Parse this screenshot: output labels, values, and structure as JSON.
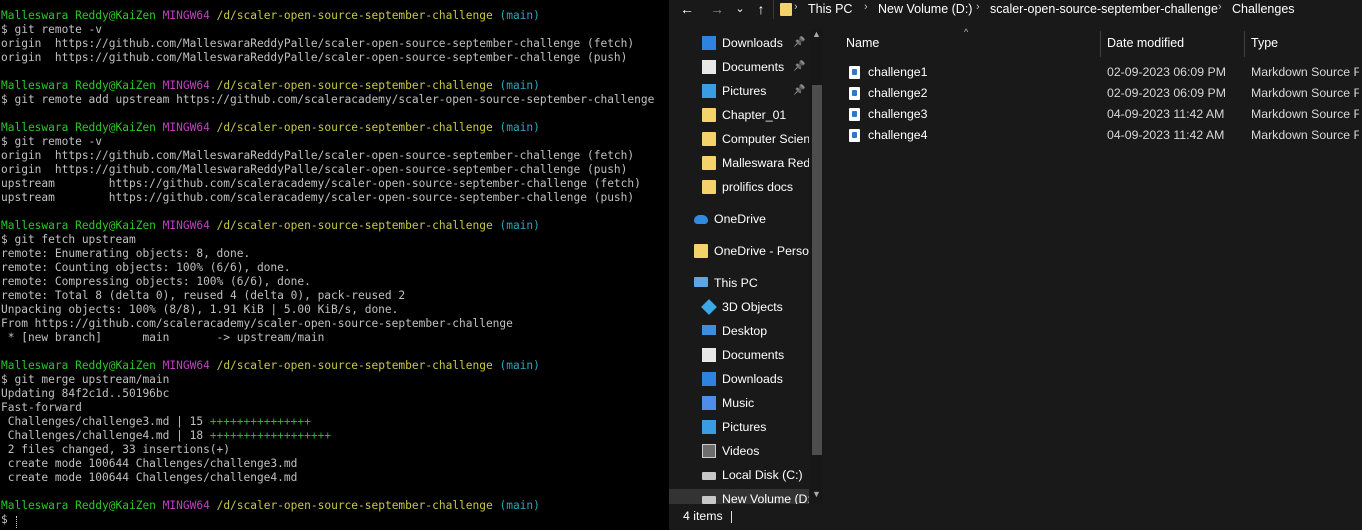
{
  "terminal": {
    "blocks": [
      {
        "prompt": {
          "user": "Malleswara Reddy@KaiZen",
          "sys": "MINGW64",
          "path": "/d/scaler-open-source-september-challenge",
          "branch": "(main)"
        },
        "command": "$ git remote -v",
        "output": [
          "origin  https://github.com/MalleswaraReddyPalle/scaler-open-source-september-challenge (fetch)",
          "origin  https://github.com/MalleswaraReddyPalle/scaler-open-source-september-challenge (push)"
        ]
      },
      {
        "prompt": {
          "user": "Malleswara Reddy@KaiZen",
          "sys": "MINGW64",
          "path": "/d/scaler-open-source-september-challenge",
          "branch": "(main)"
        },
        "command": "$ git remote add upstream https://github.com/scaleracademy/scaler-open-source-september-challenge",
        "output": []
      },
      {
        "prompt": {
          "user": "Malleswara Reddy@KaiZen",
          "sys": "MINGW64",
          "path": "/d/scaler-open-source-september-challenge",
          "branch": "(main)"
        },
        "command": "$ git remote -v",
        "output": [
          "origin  https://github.com/MalleswaraReddyPalle/scaler-open-source-september-challenge (fetch)",
          "origin  https://github.com/MalleswaraReddyPalle/scaler-open-source-september-challenge (push)",
          "upstream        https://github.com/scaleracademy/scaler-open-source-september-challenge (fetch)",
          "upstream        https://github.com/scaleracademy/scaler-open-source-september-challenge (push)"
        ]
      },
      {
        "prompt": {
          "user": "Malleswara Reddy@KaiZen",
          "sys": "MINGW64",
          "path": "/d/scaler-open-source-september-challenge",
          "branch": "(main)"
        },
        "command": "$ git fetch upstream",
        "output": [
          "remote: Enumerating objects: 8, done.",
          "remote: Counting objects: 100% (6/6), done.",
          "remote: Compressing objects: 100% (6/6), done.",
          "remote: Total 8 (delta 0), reused 4 (delta 0), pack-reused 2",
          "Unpacking objects: 100% (8/8), 1.91 KiB | 5.00 KiB/s, done.",
          "From https://github.com/scaleracademy/scaler-open-source-september-challenge",
          " * [new branch]      main       -> upstream/main"
        ]
      },
      {
        "prompt": {
          "user": "Malleswara Reddy@KaiZen",
          "sys": "MINGW64",
          "path": "/d/scaler-open-source-september-challenge",
          "branch": "(main)"
        },
        "command": "$ git merge upstream/main",
        "output": [
          "Updating 84f2c1d..50196bc",
          "Fast-forward"
        ],
        "diffstat": [
          {
            "text": " Challenges/challenge3.md | 15 ",
            "plus": "+++++++++++++++"
          },
          {
            "text": " Challenges/challenge4.md | 18 ",
            "plus": "++++++++++++++++++"
          }
        ],
        "output2": [
          " 2 files changed, 33 insertions(+)",
          " create mode 100644 Challenges/challenge3.md",
          " create mode 100644 Challenges/challenge4.md"
        ]
      },
      {
        "prompt": {
          "user": "Malleswara Reddy@KaiZen",
          "sys": "MINGW64",
          "path": "/d/scaler-open-source-september-challenge",
          "branch": "(main)"
        },
        "command": "$ ",
        "output": []
      }
    ]
  },
  "explorer": {
    "nav_buttons": {
      "back": "←",
      "forward": "→",
      "recent": "⌄",
      "up": "↑"
    },
    "breadcrumbs": [
      "This PC",
      "New Volume (D:)",
      "scaler-open-source-september-challenge",
      "Challenges"
    ],
    "breadcrumb_sep": "›",
    "nav_items": [
      {
        "label": "Downloads",
        "icon": "download-icon",
        "pinned": true
      },
      {
        "label": "Documents",
        "icon": "documents-icon",
        "pinned": true
      },
      {
        "label": "Pictures",
        "icon": "pictures-icon",
        "pinned": true
      },
      {
        "label": "Chapter_01",
        "icon": "folder-icon",
        "pinned": false
      },
      {
        "label": "Computer Scien",
        "icon": "folder-icon",
        "pinned": false
      },
      {
        "label": "Malleswara Redd",
        "icon": "folder-icon",
        "pinned": false
      },
      {
        "label": "prolifics docs",
        "icon": "folder-icon",
        "pinned": false
      },
      {
        "label": "OneDrive",
        "icon": "onedrive-cloud-icon",
        "pinned": false
      },
      {
        "label": "OneDrive - Persor",
        "icon": "folder-icon",
        "pinned": false
      },
      {
        "label": "This PC",
        "icon": "this-pc-icon",
        "pinned": false
      },
      {
        "label": "3D Objects",
        "icon": "3d-objects-icon",
        "pinned": false
      },
      {
        "label": "Desktop",
        "icon": "desktop-icon",
        "pinned": false
      },
      {
        "label": "Documents",
        "icon": "documents-icon",
        "pinned": false
      },
      {
        "label": "Downloads",
        "icon": "download-icon",
        "pinned": false
      },
      {
        "label": "Music",
        "icon": "music-icon",
        "pinned": false
      },
      {
        "label": "Pictures",
        "icon": "pictures-icon",
        "pinned": false
      },
      {
        "label": "Videos",
        "icon": "videos-icon",
        "pinned": false
      },
      {
        "label": "Local Disk (C:)",
        "icon": "local-disk-icon",
        "pinned": false
      },
      {
        "label": "New Volume (D:",
        "icon": "drive-icon",
        "pinned": false
      }
    ],
    "columns": {
      "name": "Name",
      "date": "Date modified",
      "type": "Type"
    },
    "files": [
      {
        "name": "challenge1",
        "date": "02-09-2023 06:09 PM",
        "type": "Markdown Source File"
      },
      {
        "name": "challenge2",
        "date": "02-09-2023 06:09 PM",
        "type": "Markdown Source File"
      },
      {
        "name": "challenge3",
        "date": "04-09-2023 11:42 AM",
        "type": "Markdown Source File"
      },
      {
        "name": "challenge4",
        "date": "04-09-2023 11:42 AM",
        "type": "Markdown Source File"
      }
    ],
    "status": "4 items"
  }
}
